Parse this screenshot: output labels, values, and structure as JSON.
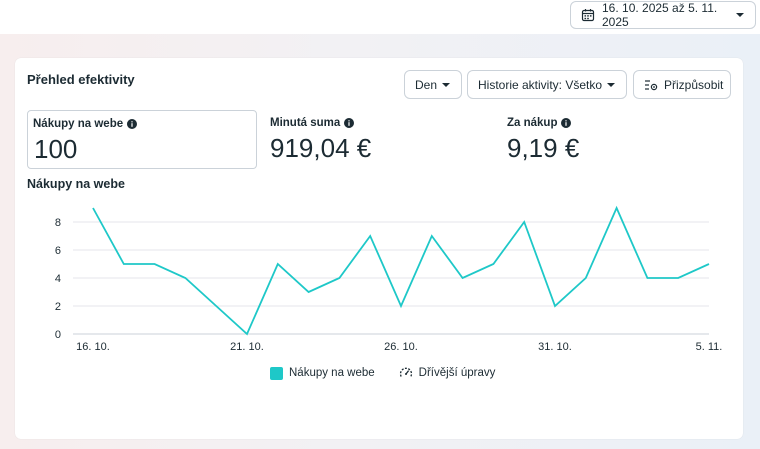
{
  "date_range": {
    "label": "16. 10. 2025 až 5. 11. 2025",
    "icon": "calendar-icon"
  },
  "card": {
    "title": "Přehled efektivity",
    "controls": {
      "granularity": "Den",
      "history": "Historie aktivity: Všetko",
      "customize": "Přizpůsobit"
    },
    "metrics": [
      {
        "label": "Nákupy na webe",
        "value": "100",
        "selected": true
      },
      {
        "label": "Minutá suma",
        "value": "919,04 €",
        "selected": false
      },
      {
        "label": "Za nákup",
        "value": "9,19 €",
        "selected": false
      }
    ],
    "chart_title": "Nákupy na webe",
    "legend": {
      "series": "Nákupy na webe",
      "previous_edits": "Dřívější úpravy"
    }
  },
  "colors": {
    "series": "#1ec8c8",
    "grid": "#e4e6eb",
    "text": "#1c2b33"
  },
  "chart_data": {
    "type": "line",
    "x": [
      "16. 10.",
      "17. 10.",
      "18. 10.",
      "19. 10.",
      "20. 10.",
      "21. 10.",
      "22. 10.",
      "23. 10.",
      "24. 10.",
      "25. 10.",
      "26. 10.",
      "27. 10.",
      "28. 10.",
      "29. 10.",
      "30. 10.",
      "31. 10.",
      "1. 11.",
      "2. 11.",
      "3. 11.",
      "4. 11.",
      "5. 11."
    ],
    "x_tick_labels": [
      "16. 10.",
      "21. 10.",
      "26. 10.",
      "31. 10.",
      "5. 11."
    ],
    "series": [
      {
        "name": "Nákupy na webe",
        "values": [
          9,
          5,
          5,
          4,
          2,
          0,
          5,
          3,
          4,
          7,
          2,
          7,
          4,
          5,
          8,
          2,
          4,
          9,
          4,
          4,
          5
        ]
      }
    ],
    "y_ticks": [
      0,
      2,
      4,
      6,
      8
    ],
    "ylim": [
      0,
      9
    ],
    "grid": true,
    "legend": "bottom"
  }
}
